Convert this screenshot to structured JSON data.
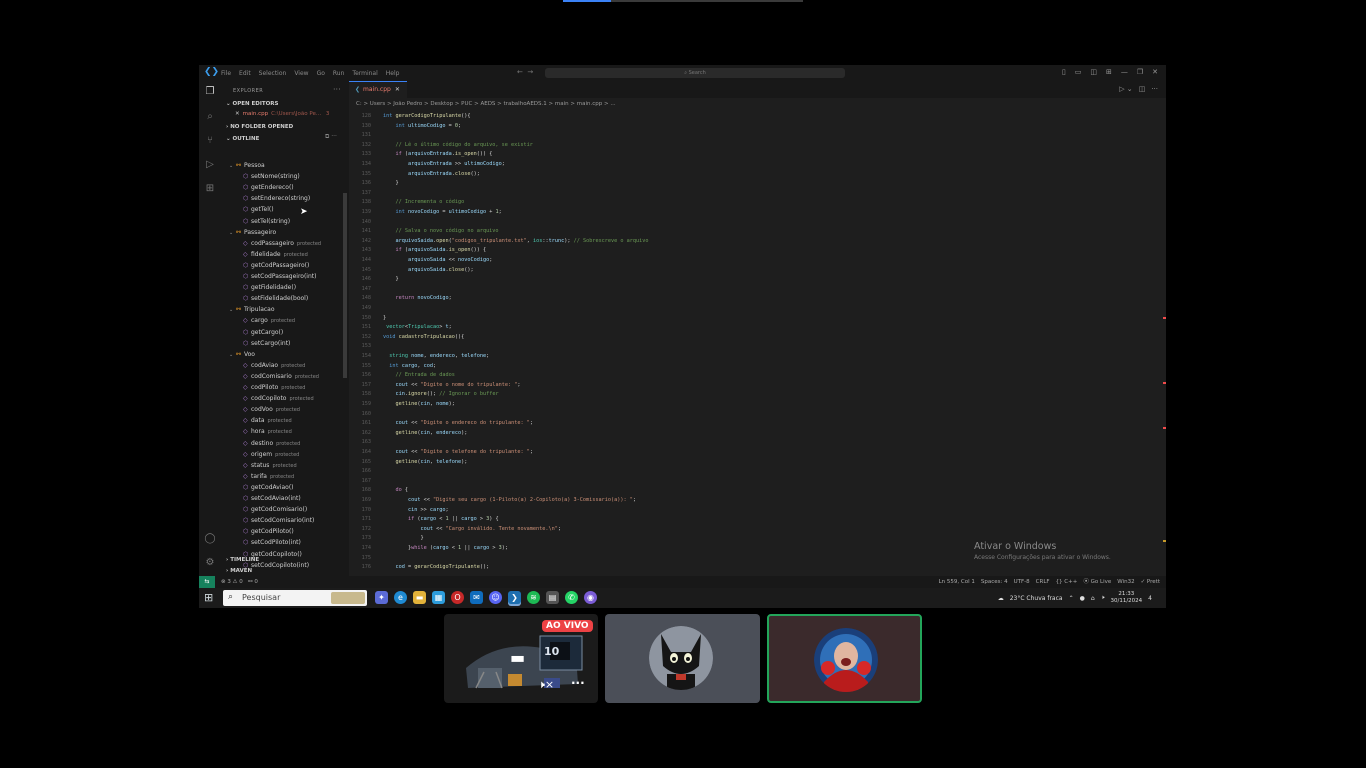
{
  "menu": [
    "File",
    "Edit",
    "Selection",
    "View",
    "Go",
    "Run",
    "Terminal",
    "Help"
  ],
  "search": {
    "placeholder": "Search"
  },
  "sidebar": {
    "title": "EXPLORER",
    "open_editors": "OPEN EDITORS",
    "open_file": "main.cpp",
    "open_file_path": "C:\\Users\\João Pe...",
    "open_file_count": "3",
    "no_folder": "NO FOLDER OPENED",
    "outline": "OUTLINE",
    "timeline": "TIMELINE",
    "maven": "MAVEN"
  },
  "outline": [
    {
      "label": "Pessoa",
      "kind": "class",
      "indent": 1
    },
    {
      "label": "setNome(string)",
      "kind": "method",
      "indent": 2
    },
    {
      "label": "getEndereco()",
      "kind": "method",
      "indent": 2
    },
    {
      "label": "setEndereco(string)",
      "kind": "method",
      "indent": 2
    },
    {
      "label": "getTel()",
      "kind": "method",
      "indent": 2
    },
    {
      "label": "setTel(string)",
      "kind": "method",
      "indent": 2
    },
    {
      "label": "Passageiro",
      "kind": "class",
      "indent": 1
    },
    {
      "label": "codPassageiro",
      "kind": "field",
      "indent": 2,
      "tag": "protected"
    },
    {
      "label": "fidelidade",
      "kind": "field",
      "indent": 2,
      "tag": "protected"
    },
    {
      "label": "getCodPassageiro()",
      "kind": "method",
      "indent": 2
    },
    {
      "label": "setCodPassageiro(int)",
      "kind": "method",
      "indent": 2
    },
    {
      "label": "getFidelidade()",
      "kind": "method",
      "indent": 2
    },
    {
      "label": "setFidelidade(bool)",
      "kind": "method",
      "indent": 2
    },
    {
      "label": "Tripulacao",
      "kind": "class",
      "indent": 1
    },
    {
      "label": "cargo",
      "kind": "field",
      "indent": 2,
      "tag": "protected"
    },
    {
      "label": "getCargo()",
      "kind": "method",
      "indent": 2
    },
    {
      "label": "setCargo(int)",
      "kind": "method",
      "indent": 2
    },
    {
      "label": "Voo",
      "kind": "class",
      "indent": 1
    },
    {
      "label": "codAviao",
      "kind": "field",
      "indent": 2,
      "tag": "protected"
    },
    {
      "label": "codComisario",
      "kind": "field",
      "indent": 2,
      "tag": "protected"
    },
    {
      "label": "codPiloto",
      "kind": "field",
      "indent": 2,
      "tag": "protected"
    },
    {
      "label": "codCopiloto",
      "kind": "field",
      "indent": 2,
      "tag": "protected"
    },
    {
      "label": "codVoo",
      "kind": "field",
      "indent": 2,
      "tag": "protected"
    },
    {
      "label": "data",
      "kind": "field",
      "indent": 2,
      "tag": "protected"
    },
    {
      "label": "hora",
      "kind": "field",
      "indent": 2,
      "tag": "protected"
    },
    {
      "label": "destino",
      "kind": "field",
      "indent": 2,
      "tag": "protected"
    },
    {
      "label": "origem",
      "kind": "field",
      "indent": 2,
      "tag": "protected"
    },
    {
      "label": "status",
      "kind": "field",
      "indent": 2,
      "tag": "protected"
    },
    {
      "label": "tarifa",
      "kind": "field",
      "indent": 2,
      "tag": "protected"
    },
    {
      "label": "getCodAviao()",
      "kind": "method",
      "indent": 2
    },
    {
      "label": "setCodAviao(int)",
      "kind": "method",
      "indent": 2
    },
    {
      "label": "getCodComisario()",
      "kind": "method",
      "indent": 2
    },
    {
      "label": "setCodComisario(int)",
      "kind": "method",
      "indent": 2
    },
    {
      "label": "getCodPiloto()",
      "kind": "method",
      "indent": 2
    },
    {
      "label": "setCodPiloto(int)",
      "kind": "method",
      "indent": 2
    },
    {
      "label": "getCodCopiloto()",
      "kind": "method",
      "indent": 2
    },
    {
      "label": "setCodCopiloto(int)",
      "kind": "method",
      "indent": 2
    }
  ],
  "tab": {
    "label": "main.cpp"
  },
  "breadcrumb": "C: > Users > João Pedro > Desktop > PUC > AEDS > trabalhoAEDS.1 > main > main.cpp > ...",
  "code": [
    {
      "n": "128",
      "seg": [
        [
          "k",
          "int "
        ],
        [
          "f",
          "gerarCodigoTripulante"
        ],
        [
          "p",
          "(){"
        ]
      ]
    },
    {
      "n": "130",
      "seg": [
        [
          "p",
          "    "
        ],
        [
          "k",
          "int "
        ],
        [
          "v",
          "ultimoCodigo"
        ],
        [
          "p",
          " = "
        ],
        [
          "n",
          "0"
        ],
        [
          "p",
          ";"
        ]
      ]
    },
    {
      "n": "131",
      "seg": []
    },
    {
      "n": "132",
      "seg": [
        [
          "c",
          "    // Lê o último código do arquivo, se existir"
        ]
      ]
    },
    {
      "n": "133",
      "seg": [
        [
          "p",
          "    "
        ],
        [
          "ctl",
          "if "
        ],
        [
          "p",
          "("
        ],
        [
          "v",
          "arquivoEntrada"
        ],
        [
          "p",
          "."
        ],
        [
          "f",
          "is_open"
        ],
        [
          "p",
          "()) {"
        ]
      ]
    },
    {
      "n": "134",
      "seg": [
        [
          "p",
          "        "
        ],
        [
          "v",
          "arquivoEntrada"
        ],
        [
          "p",
          " >> "
        ],
        [
          "v",
          "ultimoCodigo"
        ],
        [
          "p",
          ";"
        ]
      ]
    },
    {
      "n": "135",
      "seg": [
        [
          "p",
          "        "
        ],
        [
          "v",
          "arquivoEntrada"
        ],
        [
          "p",
          "."
        ],
        [
          "f",
          "close"
        ],
        [
          "p",
          "();"
        ]
      ]
    },
    {
      "n": "136",
      "seg": [
        [
          "p",
          "    }"
        ]
      ]
    },
    {
      "n": "137",
      "seg": []
    },
    {
      "n": "138",
      "seg": [
        [
          "c",
          "    // Incrementa o código"
        ]
      ]
    },
    {
      "n": "139",
      "seg": [
        [
          "p",
          "    "
        ],
        [
          "k",
          "int "
        ],
        [
          "v",
          "novoCodigo"
        ],
        [
          "p",
          " = "
        ],
        [
          "v",
          "ultimoCodigo"
        ],
        [
          "p",
          " + "
        ],
        [
          "n",
          "1"
        ],
        [
          "p",
          ";"
        ]
      ]
    },
    {
      "n": "140",
      "seg": []
    },
    {
      "n": "141",
      "seg": [
        [
          "c",
          "    // Salva o novo código no arquivo"
        ]
      ]
    },
    {
      "n": "142",
      "seg": [
        [
          "p",
          "    "
        ],
        [
          "v",
          "arquivoSaida"
        ],
        [
          "p",
          "."
        ],
        [
          "f",
          "open"
        ],
        [
          "p",
          "("
        ],
        [
          "s",
          "\"codigos_tripulante.txt\""
        ],
        [
          "p",
          ", "
        ],
        [
          "t",
          "ios"
        ],
        [
          "p",
          "::"
        ],
        [
          "v",
          "trunc"
        ],
        [
          "p",
          "); "
        ],
        [
          "c",
          "// Sobrescreve o arquivo"
        ]
      ]
    },
    {
      "n": "143",
      "seg": [
        [
          "p",
          "    "
        ],
        [
          "ctl",
          "if "
        ],
        [
          "p",
          "("
        ],
        [
          "v",
          "arquivoSaida"
        ],
        [
          "p",
          "."
        ],
        [
          "f",
          "is_open"
        ],
        [
          "p",
          "()) {"
        ]
      ]
    },
    {
      "n": "144",
      "seg": [
        [
          "p",
          "        "
        ],
        [
          "v",
          "arquivoSaida"
        ],
        [
          "p",
          " << "
        ],
        [
          "v",
          "novoCodigo"
        ],
        [
          "p",
          ";"
        ]
      ]
    },
    {
      "n": "145",
      "seg": [
        [
          "p",
          "        "
        ],
        [
          "v",
          "arquivoSaida"
        ],
        [
          "p",
          "."
        ],
        [
          "f",
          "close"
        ],
        [
          "p",
          "();"
        ]
      ]
    },
    {
      "n": "146",
      "seg": [
        [
          "p",
          "    }"
        ]
      ]
    },
    {
      "n": "147",
      "seg": []
    },
    {
      "n": "148",
      "seg": [
        [
          "p",
          "    "
        ],
        [
          "ctl",
          "return "
        ],
        [
          "v",
          "novoCodigo"
        ],
        [
          "p",
          ";"
        ]
      ]
    },
    {
      "n": "149",
      "seg": []
    },
    {
      "n": "150",
      "seg": [
        [
          "p",
          "}"
        ]
      ]
    },
    {
      "n": "151",
      "seg": [
        [
          "p",
          " "
        ],
        [
          "t",
          "vector"
        ],
        [
          "p",
          "<"
        ],
        [
          "t",
          "Tripulacao"
        ],
        [
          "p",
          "> "
        ],
        [
          "v",
          "t"
        ],
        [
          "p",
          ";"
        ]
      ]
    },
    {
      "n": "152",
      "seg": [
        [
          "k",
          "void "
        ],
        [
          "f",
          "cadastroTripulacao"
        ],
        [
          "p",
          "(){"
        ]
      ]
    },
    {
      "n": "153",
      "seg": []
    },
    {
      "n": "154",
      "seg": [
        [
          "p",
          "  "
        ],
        [
          "t",
          "string "
        ],
        [
          "v",
          "nome"
        ],
        [
          "p",
          ", "
        ],
        [
          "v",
          "endereco"
        ],
        [
          "p",
          ", "
        ],
        [
          "v",
          "telefone"
        ],
        [
          "p",
          ";"
        ]
      ]
    },
    {
      "n": "155",
      "seg": [
        [
          "p",
          "  "
        ],
        [
          "k",
          "int "
        ],
        [
          "v",
          "cargo"
        ],
        [
          "p",
          ", "
        ],
        [
          "v",
          "cod"
        ],
        [
          "p",
          ";"
        ]
      ]
    },
    {
      "n": "156",
      "seg": [
        [
          "c",
          "    // Entrada de dados"
        ]
      ]
    },
    {
      "n": "157",
      "seg": [
        [
          "p",
          "    "
        ],
        [
          "v",
          "cout"
        ],
        [
          "p",
          " << "
        ],
        [
          "s",
          "\"Digite o nome do tripulante: \""
        ],
        [
          "p",
          ";"
        ]
      ]
    },
    {
      "n": "158",
      "seg": [
        [
          "p",
          "    "
        ],
        [
          "v",
          "cin"
        ],
        [
          "p",
          "."
        ],
        [
          "f",
          "ignore"
        ],
        [
          "p",
          "(); "
        ],
        [
          "c",
          "// Ignorar o buffer"
        ]
      ]
    },
    {
      "n": "159",
      "seg": [
        [
          "p",
          "    "
        ],
        [
          "f",
          "getline"
        ],
        [
          "p",
          "("
        ],
        [
          "v",
          "cin"
        ],
        [
          "p",
          ", "
        ],
        [
          "v",
          "nome"
        ],
        [
          "p",
          ");"
        ]
      ]
    },
    {
      "n": "160",
      "seg": []
    },
    {
      "n": "161",
      "seg": [
        [
          "p",
          "    "
        ],
        [
          "v",
          "cout"
        ],
        [
          "p",
          " << "
        ],
        [
          "s",
          "\"Digite o endereco do tripulante: \""
        ],
        [
          "p",
          ";"
        ]
      ]
    },
    {
      "n": "162",
      "seg": [
        [
          "p",
          "    "
        ],
        [
          "f",
          "getline"
        ],
        [
          "p",
          "("
        ],
        [
          "v",
          "cin"
        ],
        [
          "p",
          ", "
        ],
        [
          "v",
          "endereco"
        ],
        [
          "p",
          ");"
        ]
      ]
    },
    {
      "n": "163",
      "seg": []
    },
    {
      "n": "164",
      "seg": [
        [
          "p",
          "    "
        ],
        [
          "v",
          "cout"
        ],
        [
          "p",
          " << "
        ],
        [
          "s",
          "\"Digite o telefone do tripulante: \""
        ],
        [
          "p",
          ";"
        ]
      ]
    },
    {
      "n": "165",
      "seg": [
        [
          "p",
          "    "
        ],
        [
          "f",
          "getline"
        ],
        [
          "p",
          "("
        ],
        [
          "v",
          "cin"
        ],
        [
          "p",
          ", "
        ],
        [
          "v",
          "telefone"
        ],
        [
          "p",
          ");"
        ]
      ]
    },
    {
      "n": "166",
      "seg": []
    },
    {
      "n": "167",
      "seg": []
    },
    {
      "n": "168",
      "seg": [
        [
          "p",
          "    "
        ],
        [
          "ctl",
          "do "
        ],
        [
          "p",
          "{"
        ]
      ]
    },
    {
      "n": "169",
      "seg": [
        [
          "p",
          "        "
        ],
        [
          "v",
          "cout"
        ],
        [
          "p",
          " << "
        ],
        [
          "s",
          "\"Digite seu cargo (1-Piloto(a) 2-Copiloto(a) 3-Comissario(a)): \""
        ],
        [
          "p",
          ";"
        ]
      ]
    },
    {
      "n": "170",
      "seg": [
        [
          "p",
          "        "
        ],
        [
          "v",
          "cin"
        ],
        [
          "p",
          " >> "
        ],
        [
          "v",
          "cargo"
        ],
        [
          "p",
          ";"
        ]
      ]
    },
    {
      "n": "171",
      "seg": [
        [
          "p",
          "        "
        ],
        [
          "ctl",
          "if "
        ],
        [
          "p",
          "("
        ],
        [
          "v",
          "cargo"
        ],
        [
          "p",
          " < "
        ],
        [
          "n",
          "1"
        ],
        [
          "p",
          " || "
        ],
        [
          "v",
          "cargo"
        ],
        [
          "p",
          " > "
        ],
        [
          "n",
          "3"
        ],
        [
          "p",
          ") {"
        ]
      ]
    },
    {
      "n": "172",
      "seg": [
        [
          "p",
          "            "
        ],
        [
          "v",
          "cout"
        ],
        [
          "p",
          " << "
        ],
        [
          "s",
          "\"Cargo inválido. Tente novamente.\\n\""
        ],
        [
          "p",
          ";"
        ]
      ]
    },
    {
      "n": "173",
      "seg": [
        [
          "p",
          "            }"
        ]
      ]
    },
    {
      "n": "174",
      "seg": [
        [
          "p",
          "        }"
        ],
        [
          "ctl",
          "while "
        ],
        [
          "p",
          "("
        ],
        [
          "v",
          "cargo"
        ],
        [
          "p",
          " < "
        ],
        [
          "n",
          "1"
        ],
        [
          "p",
          " || "
        ],
        [
          "v",
          "cargo"
        ],
        [
          "p",
          " > "
        ],
        [
          "n",
          "3"
        ],
        [
          "p",
          ");"
        ]
      ]
    },
    {
      "n": "175",
      "seg": []
    },
    {
      "n": "176",
      "seg": [
        [
          "p",
          "    "
        ],
        [
          "v",
          "cod"
        ],
        [
          "p",
          " = "
        ],
        [
          "f",
          "gerarCodigoTripulante"
        ],
        [
          "p",
          "();"
        ]
      ]
    },
    {
      "n": "177",
      "seg": []
    }
  ],
  "watermark": {
    "title": "Ativar o Windows",
    "subtitle": "Acesse Configurações para ativar o Windows."
  },
  "statusbar": {
    "problems": "⊗ 3 ⚠ 0",
    "ports": "⚯ 0",
    "position": "Ln 559, Col 1",
    "spaces": "Spaces: 4",
    "encoding": "UTF-8",
    "eol": "CRLF",
    "language": "{} C++",
    "golive": "Go Live",
    "platform": "Win32",
    "prettier": "✓ Prett"
  },
  "taskbar": {
    "search_placeholder": "Pesquisar",
    "weather": "23°C  Chuva fraca",
    "time": "21:33",
    "date": "30/11/2024",
    "notif_count": "4"
  },
  "call": {
    "live_badge": "AO VIVO",
    "screen_label": "10"
  },
  "colors": {
    "accent": "#3b82f6",
    "speaking_border": "#23a55a",
    "live": "#ed4245",
    "remote": "#16825d"
  }
}
